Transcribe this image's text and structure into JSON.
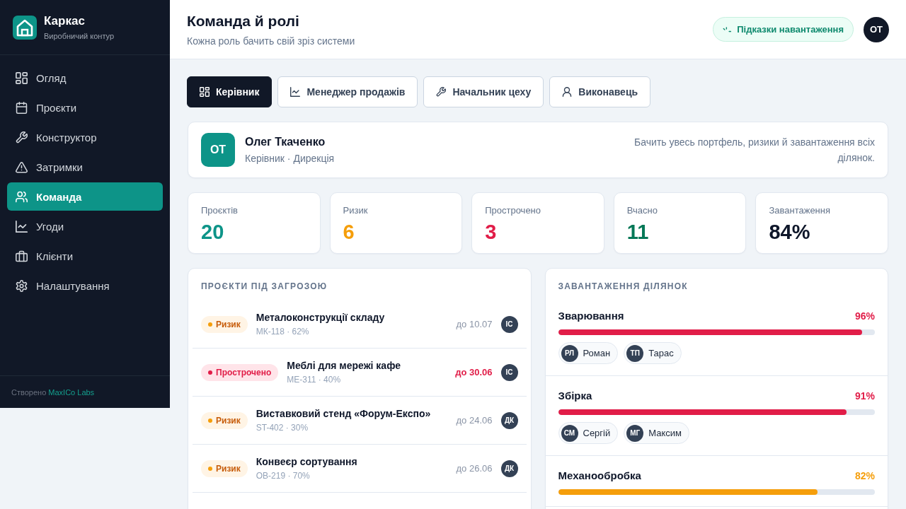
{
  "sidebar": {
    "brand": {
      "name": "Каркас",
      "subtitle": "Виробничий контур"
    },
    "items": [
      {
        "label": "Огляд",
        "selected": false
      },
      {
        "label": "Проєкти",
        "selected": false
      },
      {
        "label": "Конструктор",
        "selected": false
      },
      {
        "label": "Затримки",
        "selected": false
      },
      {
        "label": "Команда",
        "selected": true
      },
      {
        "label": "Угоди",
        "selected": false
      },
      {
        "label": "Клієнти",
        "selected": false
      },
      {
        "label": "Налаштування",
        "selected": false
      }
    ],
    "footer": {
      "text": "Створено",
      "link": "MaxICo Labs"
    }
  },
  "header": {
    "title": "Команда й ролі",
    "subtitle": "Кожна роль бачить свій зріз системи",
    "hint_button": "Підказки навантаження",
    "avatar": "ОТ"
  },
  "role_tabs": [
    {
      "label": "Керівник",
      "selected": true
    },
    {
      "label": "Менеджер продажів",
      "selected": false
    },
    {
      "label": "Начальник цеху",
      "selected": false
    },
    {
      "label": "Виконавець",
      "selected": false
    }
  ],
  "profile": {
    "initials": "ОТ",
    "name": "Олег Ткаченко",
    "role": "Керівник · Дирекція",
    "description": "Бачить увесь портфель, ризики й завантаження всіх ділянок."
  },
  "stats": [
    {
      "label": "Проєктів",
      "value": "20",
      "color": "#0d9488"
    },
    {
      "label": "Ризик",
      "value": "6",
      "color": "#f59e0b"
    },
    {
      "label": "Прострочено",
      "value": "3",
      "color": "#e11d48"
    },
    {
      "label": "Вчасно",
      "value": "11",
      "color": "#047857"
    },
    {
      "label": "Завантаження",
      "value": "84%",
      "color": "#0f172a"
    }
  ],
  "at_risk_projects": {
    "title": "ПРОЄКТИ ПІД ЗАГРОЗОЮ",
    "rows": [
      {
        "status": "Ризик",
        "kind": "risk",
        "name": "Металоконструкції складу",
        "meta": "МК-118 · 62%",
        "due": "до 10.07",
        "assignee": "ІС"
      },
      {
        "status": "Прострочено",
        "kind": "overdue",
        "name": "Меблі для мережі кафе",
        "meta": "МЕ-311 · 40%",
        "due": "до 30.06",
        "assignee": "ІС"
      },
      {
        "status": "Ризик",
        "kind": "risk",
        "name": "Виставковий стенд «Форум-Експо»",
        "meta": "ST-402 · 30%",
        "due": "до 24.06",
        "assignee": "ДК"
      },
      {
        "status": "Ризик",
        "kind": "risk",
        "name": "Конвеєр сортування",
        "meta": "ОВ-219 · 70%",
        "due": "до 26.06",
        "assignee": "ДК"
      }
    ]
  },
  "workload": {
    "title": "ЗАВАНТАЖЕННЯ ДІЛЯНОК",
    "sections": [
      {
        "name": "Зварювання",
        "reading": "96%",
        "level": 0.96,
        "color": "#e11d48",
        "people": [
          {
            "initials": "РЛ",
            "name": "Роман"
          },
          {
            "initials": "ТП",
            "name": "Тарас"
          }
        ]
      },
      {
        "name": "Збірка",
        "reading": "91%",
        "level": 0.91,
        "color": "#e11d48",
        "people": [
          {
            "initials": "СМ",
            "name": "Сергій"
          },
          {
            "initials": "МГ",
            "name": "Максим"
          }
        ]
      },
      {
        "name": "Механообробка",
        "reading": "82%",
        "level": 0.82,
        "color": "#f59e0b"
      }
    ]
  }
}
